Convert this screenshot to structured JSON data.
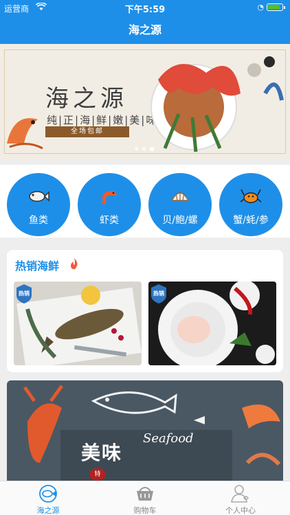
{
  "status_bar": {
    "carrier": "运营商",
    "time": "下午5:59",
    "battery_level": 0.9
  },
  "nav": {
    "title": "海之源"
  },
  "banner": {
    "title": "海之源",
    "subtitle": "纯|正|海|鲜|嫩|美|味",
    "tag": "全场包邮",
    "page_count": 3,
    "active_page": 2
  },
  "categories": [
    {
      "label": "鱼类",
      "icon": "fish-icon"
    },
    {
      "label": "虾类",
      "icon": "shrimp-icon"
    },
    {
      "label": "贝/鲍/螺",
      "icon": "shell-icon"
    },
    {
      "label": "蟹/蚝/参",
      "icon": "crab-icon"
    }
  ],
  "hot_section": {
    "title": "热销海鲜",
    "products": [
      {
        "badge": "热销",
        "image": "carp-fish-photo"
      },
      {
        "badge": "热销",
        "image": "shrimp-plate-photo"
      }
    ]
  },
  "promo": {
    "text_cn": "美味",
    "text_en": "Seafood",
    "tag": "特"
  },
  "tabbar": {
    "items": [
      {
        "label": "海之源",
        "icon": "fish-home-icon",
        "active": true
      },
      {
        "label": "购物车",
        "icon": "cart-icon",
        "active": false
      },
      {
        "label": "个人中心",
        "icon": "user-icon",
        "active": false
      }
    ]
  },
  "colors": {
    "primary": "#1E8FE8",
    "background": "#eeeeee"
  }
}
